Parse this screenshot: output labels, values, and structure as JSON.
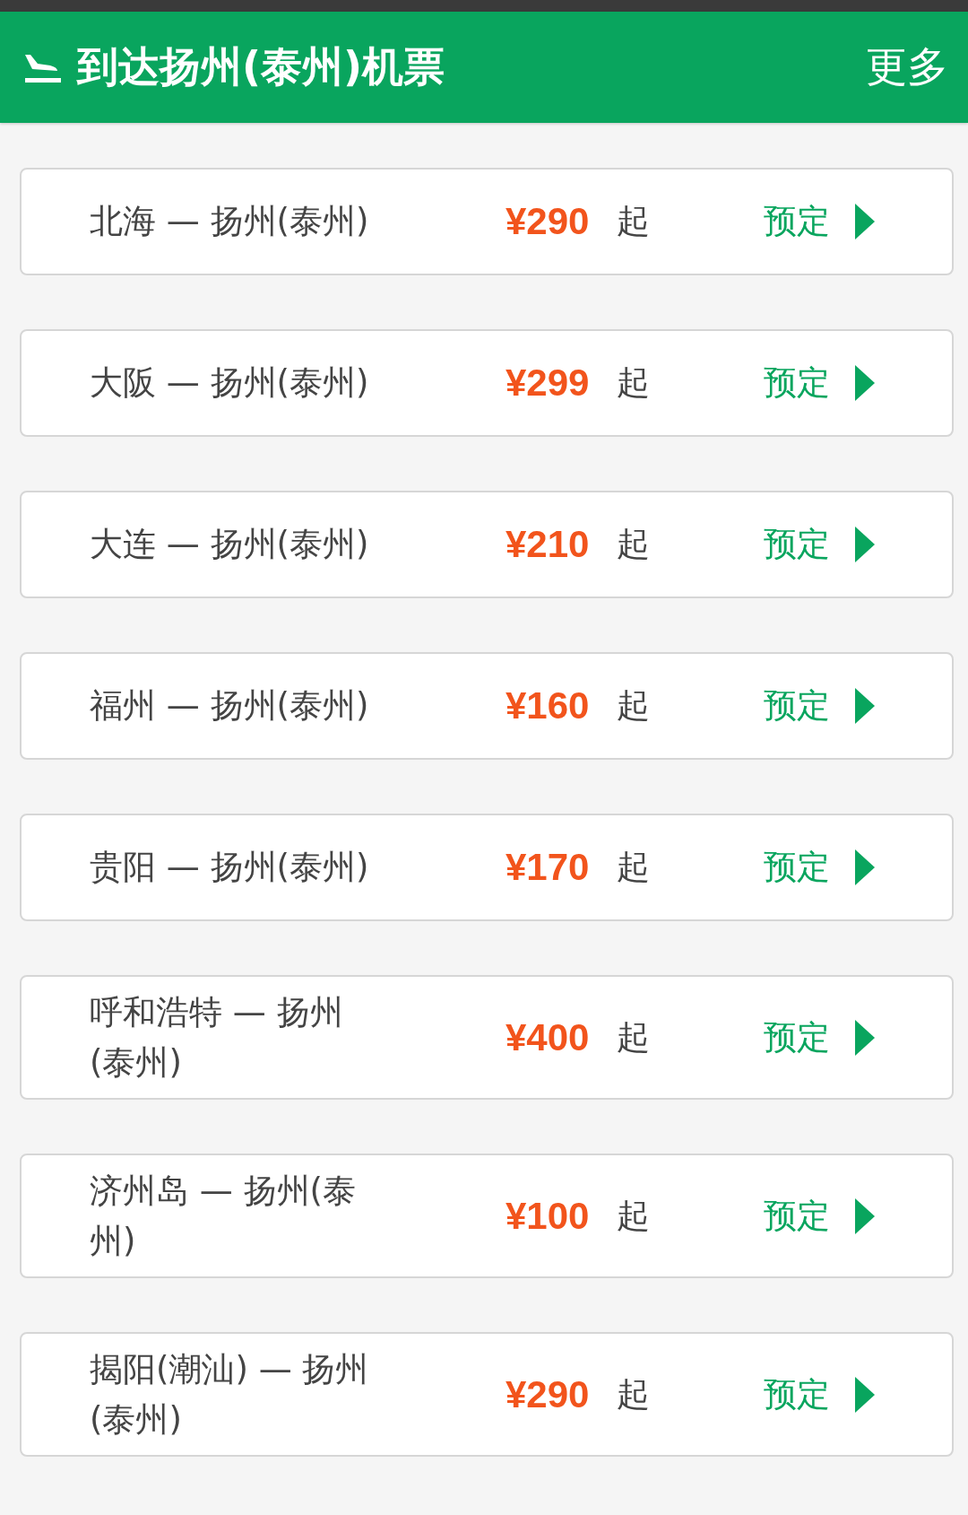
{
  "header": {
    "title": "到达扬州(泰州)机票",
    "more": "更多"
  },
  "routes": [
    {
      "route": "北海 — 扬州(泰州)",
      "price": "¥290",
      "suffix": "起",
      "action": "预定"
    },
    {
      "route": "大阪 — 扬州(泰州)",
      "price": "¥299",
      "suffix": "起",
      "action": "预定"
    },
    {
      "route": "大连 — 扬州(泰州)",
      "price": "¥210",
      "suffix": "起",
      "action": "预定"
    },
    {
      "route": "福州 — 扬州(泰州)",
      "price": "¥160",
      "suffix": "起",
      "action": "预定"
    },
    {
      "route": "贵阳 — 扬州(泰州)",
      "price": "¥170",
      "suffix": "起",
      "action": "预定"
    },
    {
      "route": "呼和浩特 — 扬州(泰州)",
      "price": "¥400",
      "suffix": "起",
      "action": "预定"
    },
    {
      "route": "济州岛 — 扬州(泰州)",
      "price": "¥100",
      "suffix": "起",
      "action": "预定"
    },
    {
      "route": "揭阳(潮汕) — 扬州(泰州)",
      "price": "¥290",
      "suffix": "起",
      "action": "预定"
    }
  ]
}
